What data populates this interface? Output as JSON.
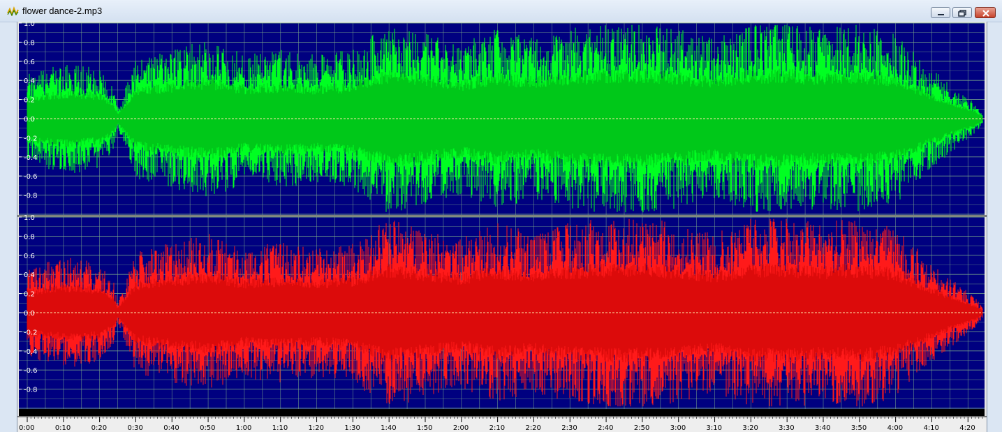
{
  "window": {
    "title": "flower dance-2.mp3",
    "icon": "waveform-app-icon",
    "buttons": [
      "minimize-button",
      "maximize-button",
      "close-button"
    ]
  },
  "colors": {
    "background": "#000080",
    "grid": "#7fb08a",
    "left_channel": "#00ff22",
    "left_channel_core": "#009a12",
    "right_channel": "#ff1a1a",
    "right_channel_core": "#c00000",
    "baseline": "#ffe9a8"
  },
  "channels": [
    {
      "name": "left",
      "y_labels": [
        "1.0",
        "0.8",
        "0.6",
        "0.4",
        "0.2",
        "0.0",
        "-0.2",
        "-0.4",
        "-0.6",
        "-0.8"
      ]
    },
    {
      "name": "right",
      "y_labels": [
        "1.0",
        "0.8",
        "0.6",
        "0.4",
        "0.2",
        "0.0",
        "-0.2",
        "-0.4",
        "-0.6",
        "-0.8"
      ]
    }
  ],
  "timeline": {
    "labels": [
      "0:00",
      "0:10",
      "0:20",
      "0:30",
      "0:40",
      "0:50",
      "1:00",
      "1:10",
      "1:20",
      "1:30",
      "1:40",
      "1:50",
      "2:00",
      "2:10",
      "2:20",
      "2:30",
      "2:40",
      "2:50",
      "3:00",
      "3:10",
      "3:20",
      "3:30",
      "3:40",
      "3:50",
      "4:00",
      "4:10",
      "4:20"
    ],
    "duration_seconds": 264
  },
  "chart_data": {
    "type": "area",
    "x_unit": "seconds",
    "y_range": [
      -1.0,
      1.0
    ],
    "series": [
      {
        "name": "",
        "envelope_time": [
          0,
          5,
          12,
          20,
          24,
          25,
          30,
          40,
          50,
          60,
          70,
          80,
          90,
          100,
          110,
          120,
          130,
          140,
          150,
          160,
          170,
          180,
          190,
          200,
          210,
          220,
          230,
          240,
          250,
          255,
          262,
          264
        ],
        "envelope_amp": [
          0.45,
          0.5,
          0.55,
          0.5,
          0.3,
          0.1,
          0.6,
          0.7,
          0.8,
          0.65,
          0.7,
          0.65,
          0.7,
          0.95,
          0.85,
          0.75,
          0.9,
          0.8,
          0.9,
          0.95,
          0.95,
          0.9,
          0.8,
          0.95,
          0.95,
          0.9,
          0.95,
          0.85,
          0.5,
          0.35,
          0.15,
          0.05
        ]
      },
      {
        "name": "",
        "envelope_time": [
          0,
          5,
          12,
          20,
          24,
          25,
          30,
          40,
          50,
          60,
          70,
          80,
          90,
          100,
          110,
          120,
          130,
          140,
          150,
          160,
          170,
          180,
          190,
          200,
          210,
          220,
          230,
          240,
          250,
          255,
          262,
          264
        ],
        "envelope_amp": [
          0.45,
          0.5,
          0.55,
          0.5,
          0.3,
          0.1,
          0.6,
          0.7,
          0.8,
          0.65,
          0.7,
          0.65,
          0.7,
          0.95,
          0.85,
          0.75,
          0.9,
          0.8,
          0.9,
          0.95,
          0.95,
          0.9,
          0.8,
          0.95,
          0.95,
          0.9,
          0.95,
          0.85,
          0.5,
          0.35,
          0.15,
          0.05
        ]
      }
    ]
  }
}
